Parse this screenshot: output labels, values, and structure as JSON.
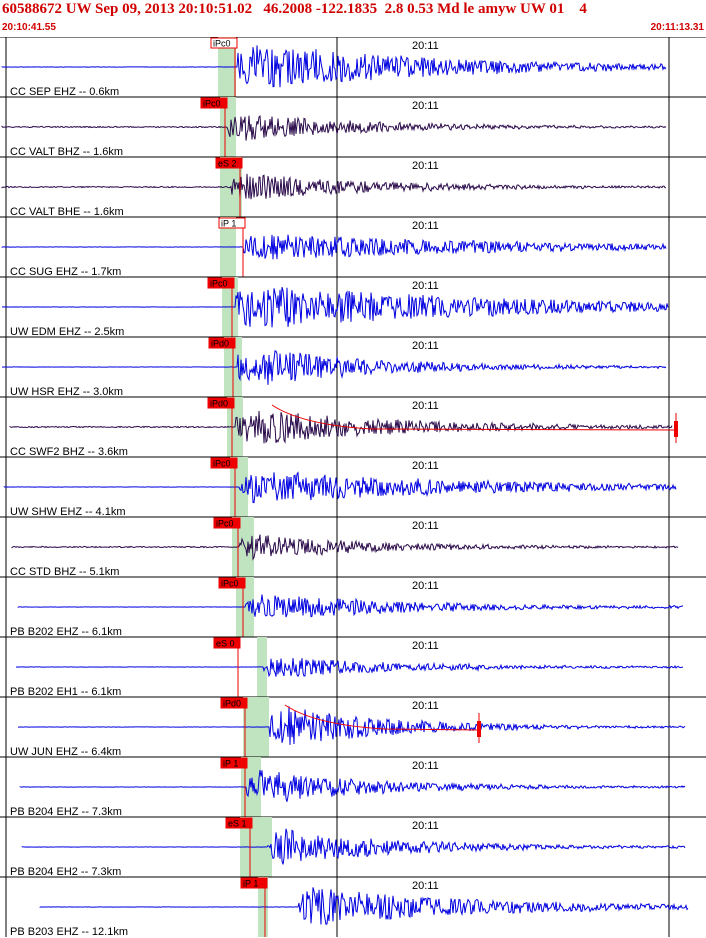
{
  "header": {
    "title": "60588672 UW Sep 09, 2013 20:10:51.02   46.2008 -122.1835  2.8 0.53 Md le amyw UW 01    4",
    "start_time": "20:10:41.55",
    "end_time": "20:11:13.31"
  },
  "time_label": "20:11",
  "colors": {
    "header_text": "#d10000",
    "trace_blue": "#0000e0",
    "trace_dark": "#2a0a4a",
    "pick_red": "#ee0000",
    "window_green": "#bfe4bf"
  },
  "traces": [
    {
      "label": "CC SEP EHZ -- 0.6km",
      "pick": "iPc0",
      "color": "blue"
    },
    {
      "label": "CC VALT BHZ -- 1.6km",
      "pick": "iPc0",
      "color": "dark"
    },
    {
      "label": "CC VALT BHE -- 1.6km",
      "pick": "eS 2",
      "color": "dark"
    },
    {
      "label": "CC SUG EHZ -- 1.7km",
      "pick": "iP 1",
      "color": "blue"
    },
    {
      "label": "UW EDM EHZ -- 2.5km",
      "pick": "iPc0",
      "color": "blue"
    },
    {
      "label": "UW HSR EHZ -- 3.0km",
      "pick": "iPd0",
      "color": "blue"
    },
    {
      "label": "CC SWF2 BHZ -- 3.6km",
      "pick": "iPd0",
      "color": "dark"
    },
    {
      "label": "UW SHW EHZ -- 4.1km",
      "pick": "iPc0",
      "color": "blue"
    },
    {
      "label": "CC STD BHZ -- 5.1km",
      "pick": "iPc0",
      "color": "dark"
    },
    {
      "label": "PB B202 EHZ -- 6.1km",
      "pick": "iPc0",
      "color": "blue"
    },
    {
      "label": "PB B202 EH1 -- 6.1km",
      "pick": "eS 0",
      "color": "blue"
    },
    {
      "label": "UW JUN EHZ -- 6.4km",
      "pick": "iPd0",
      "color": "blue"
    },
    {
      "label": "PB B204 EHZ -- 7.3km",
      "pick": "iP 1",
      "color": "blue"
    },
    {
      "label": "PB B204 EH2 -- 7.3km",
      "pick": "eS 1",
      "color": "blue"
    },
    {
      "label": "PB B203 EHZ -- 12.1km",
      "pick": "iP 1",
      "color": "blue"
    }
  ]
}
